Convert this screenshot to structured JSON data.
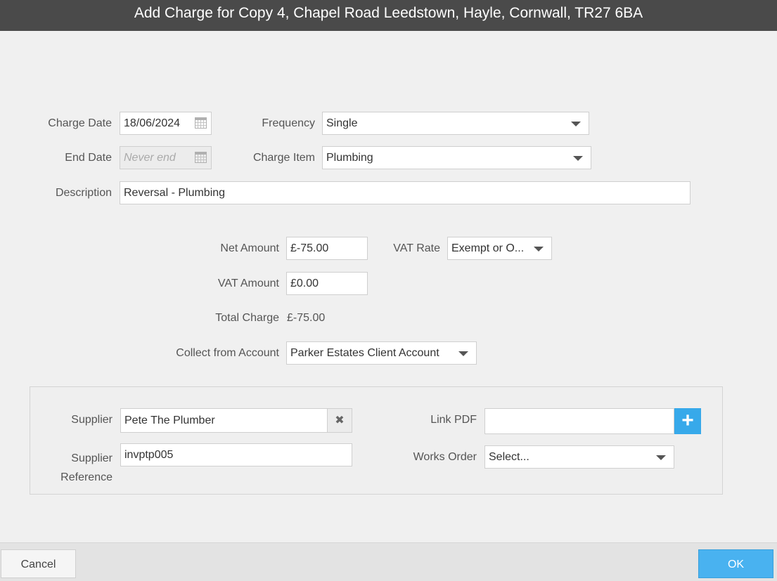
{
  "dialog": {
    "title": "Add Charge for Copy 4, Chapel Road Leedstown, Hayle, Cornwall, TR27 6BA"
  },
  "form": {
    "charge_date_label": "Charge Date",
    "charge_date_value": "18/06/2024",
    "end_date_label": "End Date",
    "end_date_placeholder": "Never end",
    "frequency_label": "Frequency",
    "frequency_value": "Single",
    "charge_item_label": "Charge Item",
    "charge_item_value": "Plumbing",
    "description_label": "Description",
    "description_value": "Reversal - Plumbing",
    "net_amount_label": "Net Amount",
    "net_amount_value": "£-75.00",
    "vat_rate_label": "VAT Rate",
    "vat_rate_value": "Exempt or O...",
    "vat_amount_label": "VAT Amount",
    "vat_amount_value": "£0.00",
    "total_charge_label": "Total Charge",
    "total_charge_value": "£-75.00",
    "collect_from_label": "Collect from Account",
    "collect_from_value": "Parker Estates Client Account"
  },
  "supplier_panel": {
    "supplier_label": "Supplier",
    "supplier_value": "Pete The Plumber",
    "supplier_ref_label_line1": "Supplier",
    "supplier_ref_label_line2": "Reference",
    "supplier_ref_value": "invptp005",
    "link_pdf_label": "Link PDF",
    "link_pdf_value": "",
    "works_order_label": "Works Order",
    "works_order_value": "Select..."
  },
  "footer": {
    "cancel_label": "Cancel",
    "ok_label": "OK"
  },
  "icons": {
    "calendar": "calendar-icon",
    "dropdown": "chevron-down-icon",
    "clear": "close-icon",
    "add": "plus-icon"
  },
  "colors": {
    "titlebar": "#4a4a4a",
    "accent": "#49b2f0",
    "background": "#f0f0f0"
  }
}
